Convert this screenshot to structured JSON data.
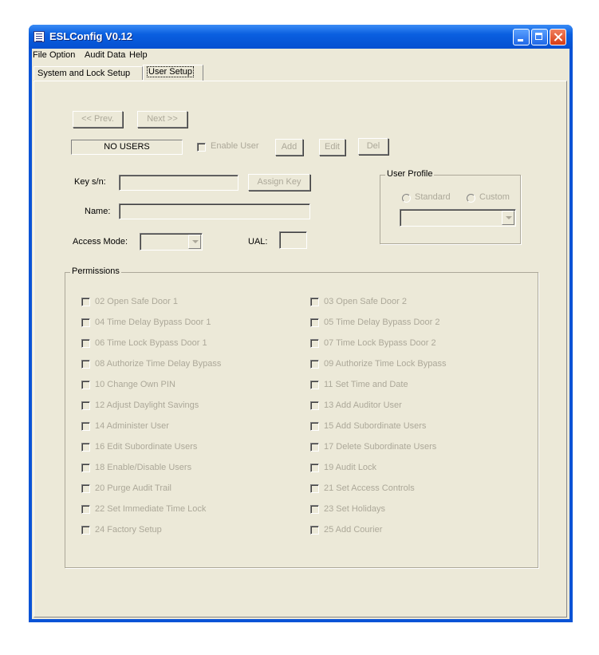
{
  "window": {
    "title": "ESLConfig V0.12"
  },
  "menu": [
    "File",
    "Option",
    "Audit Data",
    "Help"
  ],
  "tabs": [
    "System and Lock Setup",
    "User Setup"
  ],
  "nav": {
    "prev": "<< Prev.",
    "next": "Next >>"
  },
  "user_status": "NO USERS",
  "enable_user": "Enable User",
  "buttons": {
    "add": "Add",
    "edit": "Edit",
    "del": "Del",
    "assign_key": "Assign Key"
  },
  "labels": {
    "key_sn": "Key s/n:",
    "name": "Name:",
    "access_mode": "Access Mode:",
    "ual": "UAL:"
  },
  "fields": {
    "key_sn": "",
    "name": "",
    "access_mode": "",
    "ual": ""
  },
  "user_profile": {
    "title": "User Profile",
    "standard": "Standard",
    "custom": "Custom",
    "selected": ""
  },
  "permissions": {
    "title": "Permissions",
    "left": [
      "02  Open Safe Door 1",
      "04  Time Delay Bypass Door 1",
      "06  Time Lock Bypass Door 1",
      "08  Authorize Time Delay Bypass",
      "10  Change Own PIN",
      "12  Adjust Daylight Savings",
      "14  Administer User",
      "16  Edit Subordinate Users",
      "18  Enable/Disable Users",
      "20  Purge Audit  Trail",
      "22  Set Immediate Time Lock",
      "24  Factory Setup"
    ],
    "right": [
      "03  Open Safe Door 2",
      "05  Time Delay Bypass Door 2",
      "07  Time Lock Bypass Door 2",
      "09  Authorize Time Lock Bypass",
      "11  Set Time and Date",
      "13  Add Auditor User",
      "15  Add Subordinate Users",
      "17  Delete Subordinate Users",
      "19  Audit Lock",
      "21  Set Access Controls",
      "23  Set Holidays",
      "25   Add Courier"
    ]
  }
}
